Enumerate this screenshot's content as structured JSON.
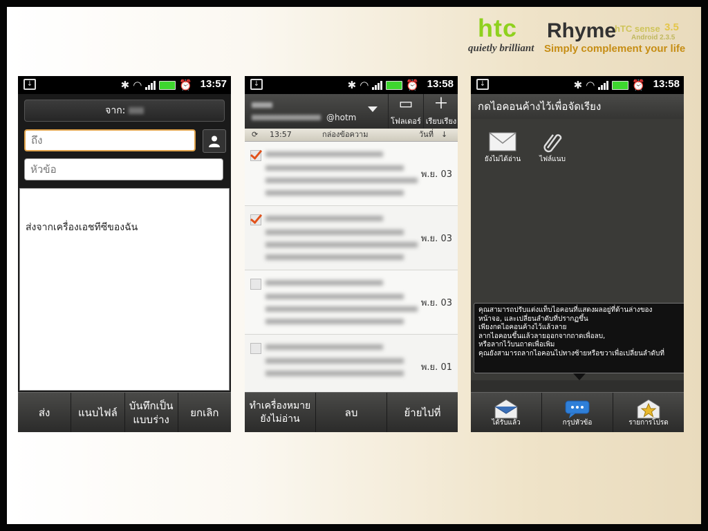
{
  "status_bar": {
    "time_1": "13:57",
    "time_2": "13:58",
    "time_3": "13:58"
  },
  "compose": {
    "from_label": "จาก:",
    "to_placeholder": "ถึง",
    "subject_placeholder": "หัวข้อ",
    "body_text": "ส่งจากเครื่องเอชทีซีของฉัน",
    "toolbar": {
      "send": "ส่ง",
      "attach": "แนบไฟล์",
      "save_draft": "บันทึกเป็นแบบร่าง",
      "cancel": "ยกเลิก"
    }
  },
  "inbox": {
    "account_suffix": "@hotm",
    "folder_label": "โฟลเดอร์",
    "sort_label": "เรียบเรียง",
    "sync_time": "13:57",
    "folder_title": "กล่องข้อความ",
    "sort_field": "วันที่",
    "messages": [
      {
        "date": "พ.ย. 03",
        "checked": true
      },
      {
        "date": "พ.ย. 03",
        "checked": true
      },
      {
        "date": "พ.ย. 03",
        "checked": false
      },
      {
        "date": "พ.ย. 01",
        "checked": false
      }
    ],
    "toolbar": {
      "mark_unread": "ทำเครื่องหมายยังไม่อ่าน",
      "delete": "ลบ",
      "move_to": "ย้ายไปที่"
    }
  },
  "arrange": {
    "header": "กดไอคอนค้างไว้เพื่อจัดเรียง",
    "slot_unread": "ยังไม่ได้อ่าน",
    "slot_attachment": "ไฟล์แนบ",
    "hint_lines": [
      "คุณสามารถปรับแต่งแท็บไอคอนที่แสดงผลอยู่ที่ด้านล่างของ",
      "หน้าจอ, และเปลี่ยนลำดับที่ปรากฏขึ้น",
      "เพียงกดไอคอนค้างไว้แล้วลาย",
      "ลากไอคอนขึ้นแล้วลายออกจากถาดเพื่อลบ,",
      "หรือลากไว้บนถาดเพื่อเพิ่ม",
      "คุณยังสามารถลากไอคอนไปทางซ้ายหรือขวาเพื่อเปลี่ยนลำดับที่"
    ],
    "tabs": {
      "received": "ได้รับแล้ว",
      "group_by_subject": "กรุปหัวข้อ",
      "favorites": "รายการโปรด"
    }
  },
  "branding": {
    "logo": "htc",
    "model": "Rhyme",
    "sense": "hTC sense",
    "sense_version": "3.5",
    "android": "Android 2.3.5",
    "slogan": "quietly brilliant",
    "tagline": "Simply complement your life"
  },
  "colors": {
    "htc_green": "#8fd11e",
    "check_orange": "#e2521b",
    "battery_green": "#3ed62f",
    "tagline_gold": "#c68d14"
  }
}
